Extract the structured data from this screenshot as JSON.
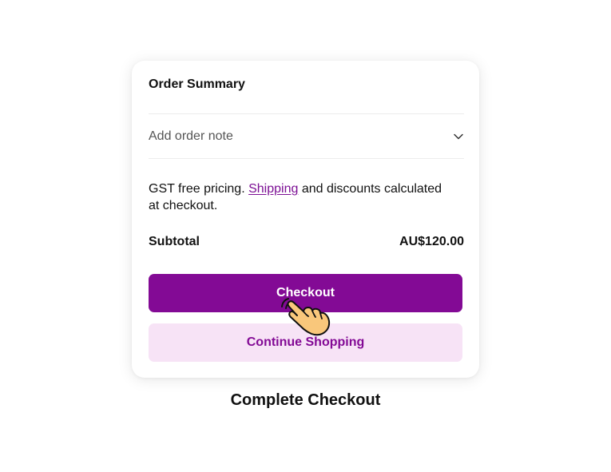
{
  "card": {
    "title": "Order Summary",
    "order_note": {
      "label": "Add order note",
      "icon": "chevron-down-icon"
    },
    "info": {
      "prefix": "GST free pricing. ",
      "link": "Shipping",
      "suffix": " and discounts calculated at checkout."
    },
    "subtotal": {
      "label": "Subtotal",
      "value": "AU$120.00"
    },
    "buttons": {
      "checkout": "Checkout",
      "continue": "Continue Shopping"
    }
  },
  "cursor": {
    "icon": "pointing-hand-cursor-icon"
  },
  "caption": "Complete Checkout",
  "colors": {
    "primary": "#830a95",
    "primary_light": "#f7e3f6",
    "link": "#7c0f94",
    "hand_fill": "#f9c77b"
  }
}
